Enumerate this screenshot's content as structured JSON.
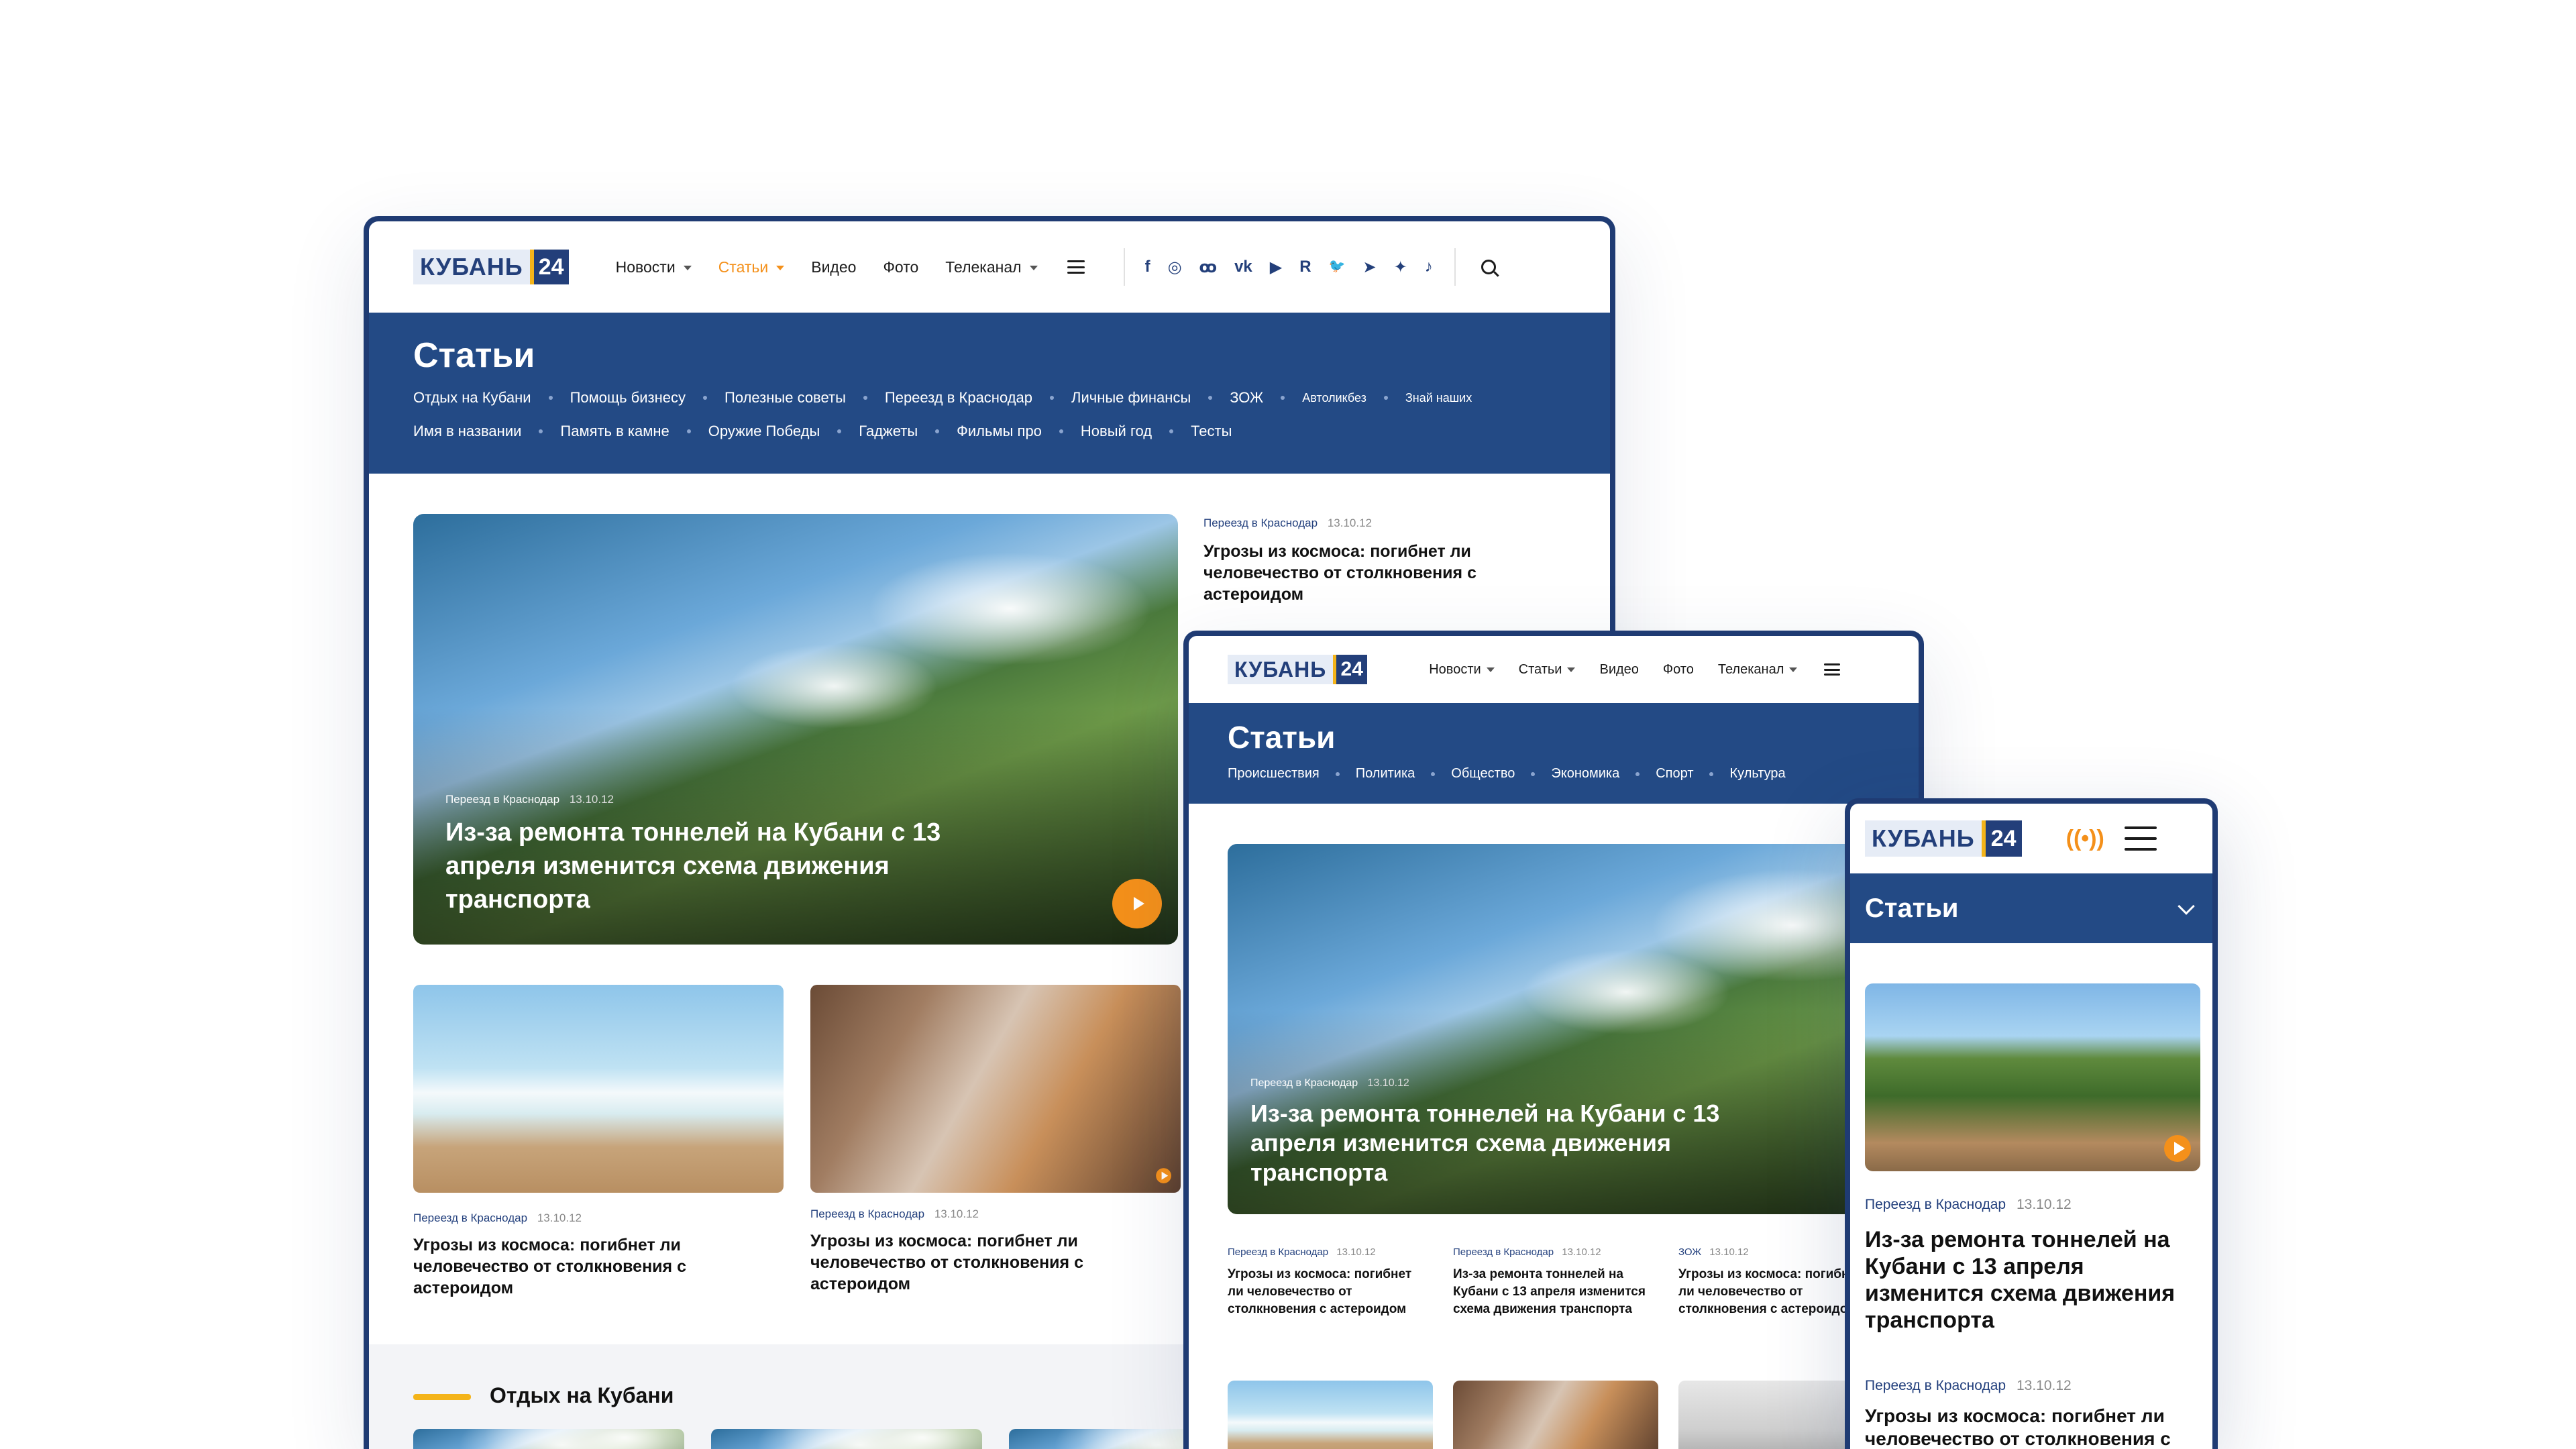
{
  "brand": {
    "logo_text": "КУБАНЬ",
    "logo_number": "24"
  },
  "colors": {
    "brand_blue": "#234a85",
    "accent_orange": "#f4901a",
    "yellow_bar": "#f4b41a"
  },
  "desktop": {
    "nav": [
      {
        "label": "Новости",
        "has_dropdown": true
      },
      {
        "label": "Статьи",
        "has_dropdown": true,
        "active": true
      },
      {
        "label": "Видео"
      },
      {
        "label": "Фото"
      },
      {
        "label": "Телеканал",
        "has_dropdown": true
      }
    ],
    "social_icons": [
      "facebook-icon",
      "instagram-icon",
      "odnoklassniki-icon",
      "vk-icon",
      "youtube-icon",
      "rutube-icon",
      "twitter-icon",
      "telegram-icon",
      "zen-icon",
      "tiktok-icon"
    ],
    "social_glyphs": [
      "f",
      "◎",
      "ꝏ",
      "ᴠk",
      "▶",
      "R",
      "🐦",
      "➤",
      "✦",
      "♪"
    ],
    "page_title": "Статьи",
    "categories_row1": [
      "Отдых на Кубани",
      "Помощь бизнесу",
      "Полезные советы",
      "Переезд в Краснодар",
      "Личные финансы",
      "ЗОЖ",
      "Автоликбез",
      "Знай наших"
    ],
    "categories_row2": [
      "Имя в названии",
      "Память в камне",
      "Оружие Победы",
      "Гаджеты",
      "Фильмы про",
      "Новый год",
      "Тесты"
    ],
    "hero": {
      "rubric": "Переезд в Краснодар",
      "date": "13.10.12",
      "title": "Из-за ремонта тоннелей на Кубани с 13 апреля изменится схема движения транспорта"
    },
    "side_article": {
      "rubric": "Переезд в Краснодар",
      "date": "13.10.12",
      "title": "Угрозы из космоса: погибнет ли человечество от столкновения с астероидом"
    },
    "cards": [
      {
        "rubric": "Переезд в Краснодар",
        "date": "13.10.12",
        "title": "Угрозы из космоса: погибнет ли человечество от столкновения с астероидом"
      },
      {
        "rubric": "Переезд в Краснодар",
        "date": "13.10.12",
        "title": "Угрозы из космоса: погибнет ли человечество от столкновения с астероидом"
      }
    ],
    "section_title": "Отдых на Кубани"
  },
  "tablet": {
    "nav": [
      {
        "label": "Новости",
        "has_dropdown": true
      },
      {
        "label": "Статьи",
        "has_dropdown": true
      },
      {
        "label": "Видео"
      },
      {
        "label": "Фото"
      },
      {
        "label": "Телеканал",
        "has_dropdown": true
      }
    ],
    "page_title": "Статьи",
    "categories": [
      "Происшествия",
      "Политика",
      "Общество",
      "Экономика",
      "Спорт",
      "Культура"
    ],
    "hero": {
      "rubric": "Переезд в Краснодар",
      "date": "13.10.12",
      "title": "Из-за ремонта тоннелей на Кубани с 13 апреля изменится схема движения транспорта"
    },
    "cards": [
      {
        "rubric": "Переезд в Краснодар",
        "date": "13.10.12",
        "title": "Угрозы из космоса: погибнет ли человечество от столкновения с астероидом"
      },
      {
        "rubric": "Переезд в Краснодар",
        "date": "13.10.12",
        "title": "Из-за ремонта тоннелей на Кубани с 13 апреля изменится схема движения транспорта"
      },
      {
        "rubric": "ЗОЖ",
        "date": "13.10.12",
        "title": "Угрозы из космоса: погибнет ли человечество от столкновения с астероидом"
      }
    ]
  },
  "mobile": {
    "page_title": "Статьи",
    "hero": {
      "rubric": "Переезд в Краснодар",
      "date": "13.10.12",
      "title": "Из-за ремонта тоннелей на Кубани с 13 апреля изменится схема движения транспорта"
    },
    "second": {
      "rubric": "Переезд в Краснодар",
      "date": "13.10.12",
      "title": "Угрозы из космоса: погибнет ли человечество от столкновения с астероидом"
    }
  }
}
